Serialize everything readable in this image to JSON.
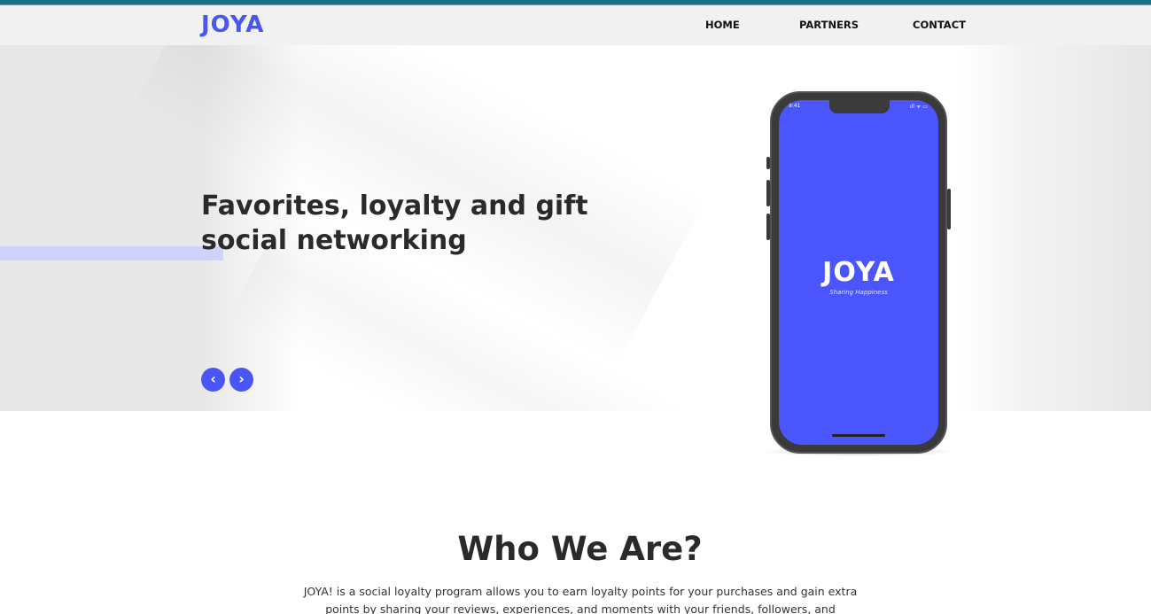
{
  "brand": {
    "logo": "JOYA",
    "accent_color": "#4a55f5"
  },
  "nav": {
    "items": [
      {
        "label": "HOME"
      },
      {
        "label": "PARTNERS"
      },
      {
        "label": "CONTACT"
      }
    ]
  },
  "hero": {
    "headline_line1": "Favorites, loyalty and gift",
    "headline_line2": "social networking",
    "prev_label": "‹",
    "next_label": "›"
  },
  "phone": {
    "status_time": "9:41",
    "status_icons": "ıll ᯤ ▭",
    "app_logo": "JOYA",
    "app_tagline": "Sharing Happiness",
    "screen_color": "#4a55fb"
  },
  "about": {
    "title": "Who We Are?",
    "text": "JOYA! is a social loyalty program allows you to earn loyalty points for your purchases and gain extra points by sharing your reviews, experiences, and moments with your friends, followers, and community."
  }
}
